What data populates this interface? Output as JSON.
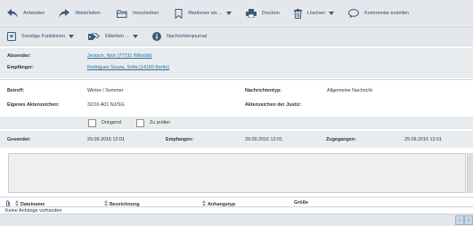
{
  "toolbar": {
    "row1": [
      {
        "label": "Antworten",
        "icon": "reply-icon"
      },
      {
        "label": "Weiterleiten",
        "icon": "forward-icon"
      },
      {
        "label": "Verschieben",
        "icon": "folder-icon"
      },
      {
        "label": "Markieren als ...",
        "icon": "bookmark-icon"
      },
      {
        "label": "Drucken",
        "icon": "print-icon"
      },
      {
        "label": "Löschen",
        "icon": "trash-icon"
      },
      {
        "label": "Kommentar erstellen",
        "icon": "comment-icon"
      }
    ],
    "row2": [
      {
        "label": "Sonstige Funktionen",
        "icon": "dropdown-box-icon"
      },
      {
        "label": "Etiketten ...",
        "icon": "tag-icon"
      },
      {
        "label": "Nachrichtenjournal",
        "icon": "info-icon"
      }
    ]
  },
  "header": {
    "sender_label": "Absender:",
    "sender_value": "Jentsch, Nick (77731 Willstätt)",
    "recipient_label": "Empfänger:",
    "recipient_value": "Rodrigues Souza, Sofia (14169 Berlin)"
  },
  "details": {
    "subject_label": "Betreff:",
    "subject_value": "Winter / Sommer",
    "type_label": "Nachrichtentyp:",
    "type_value": "Allgemeine Nachricht",
    "own_ref_label": "Eigenes Aktenzeichen:",
    "own_ref_value": "32/16 A01 NJ/SG",
    "court_ref_label": "Aktenzeichen der Justiz:",
    "court_ref_value": "",
    "urgent_label": "Dringend",
    "check_label": "Zu prüfen"
  },
  "dates": {
    "sent_label": "Gesendet:",
    "sent_value": "29.09.2016 12:01",
    "received_label": "Empfangen:",
    "received_value": "29.09.2016 12:01",
    "delivered_label": "Zugegangen:",
    "delivered_value": "29.09.2016 12:01"
  },
  "attachments": {
    "columns": [
      "Dateiname",
      "Bezeichnung",
      "Anhangstyp",
      "Größe"
    ],
    "empty_text": "Keine Anhänge vorhanden"
  },
  "colors": {
    "accent": "#2a6f9e",
    "icon": "#3c5a78"
  }
}
